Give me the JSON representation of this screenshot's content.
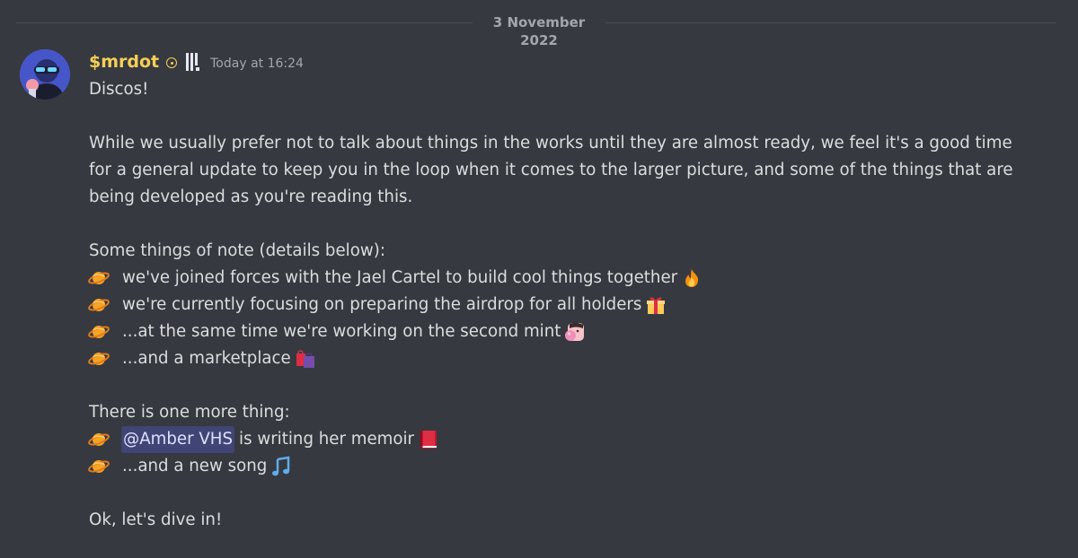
{
  "divider": {
    "date": "3 November 2022"
  },
  "message": {
    "author": "$mrdot",
    "timestamp": "Today at 16:24",
    "greeting": "Discos!",
    "paragraph_lines": [
      "While we usually prefer not to talk about things in the works until they are almost ready, we feel it's a good time",
      "for a general update to keep you in the loop when it comes to the larger picture, and some of the things that are",
      "being developed as you're reading this."
    ],
    "notes_heading": "Some things of note (details below):",
    "notes": [
      {
        "text": "we've joined forces with the Jael Cartel to build cool things together",
        "trailing_emoji": "fire-icon"
      },
      {
        "text": "we're currently focusing on preparing the airdrop for all holders",
        "trailing_emoji": "gift-icon"
      },
      {
        "text": "...at the same time we're working on the second mint",
        "trailing_emoji": "bubblegum-face-icon"
      },
      {
        "text": "...and a marketplace",
        "trailing_emoji": "shopping-bags-icon"
      }
    ],
    "more_heading": "There is one more thing:",
    "more": {
      "mention": "@Amber VHS",
      "memoir_text": "is writing her memoir",
      "song_text": "...and a new song"
    },
    "closing": "Ok, let's dive in!"
  },
  "colors": {
    "background": "#36393f",
    "username": "#f6cf57",
    "text": "#dcddde",
    "muted": "#a3a6aa",
    "mention_bg": "rgba(88,101,242,0.3)"
  },
  "icons": {
    "bullet": "ringed-planet-icon",
    "status": "moon-status-icon",
    "role": "role-badge-icon"
  }
}
